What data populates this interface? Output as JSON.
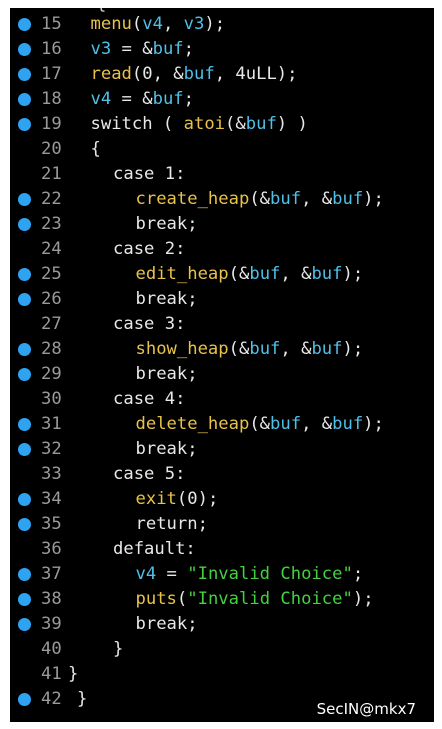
{
  "code_lines": [
    {
      "num": "15",
      "bp": true,
      "indent": 2,
      "tokens": [
        [
          "fn",
          "menu"
        ],
        [
          "p",
          "("
        ],
        [
          "var",
          "v4"
        ],
        [
          "p",
          ", "
        ],
        [
          "var",
          "v3"
        ],
        [
          "p",
          ");"
        ]
      ]
    },
    {
      "num": "16",
      "bp": true,
      "indent": 2,
      "tokens": [
        [
          "var",
          "v3"
        ],
        [
          "p",
          " = &"
        ],
        [
          "var",
          "buf"
        ],
        [
          "p",
          ";"
        ]
      ]
    },
    {
      "num": "17",
      "bp": true,
      "indent": 2,
      "tokens": [
        [
          "fn",
          "read"
        ],
        [
          "p",
          "(0, &"
        ],
        [
          "var",
          "buf"
        ],
        [
          "p",
          ", 4uLL);"
        ]
      ]
    },
    {
      "num": "18",
      "bp": true,
      "indent": 2,
      "tokens": [
        [
          "var",
          "v4"
        ],
        [
          "p",
          " = &"
        ],
        [
          "var",
          "buf"
        ],
        [
          "p",
          ";"
        ]
      ]
    },
    {
      "num": "19",
      "bp": true,
      "indent": 2,
      "tokens": [
        [
          "p",
          "switch ( "
        ],
        [
          "fn",
          "atoi"
        ],
        [
          "p",
          "(&"
        ],
        [
          "var",
          "buf"
        ],
        [
          "p",
          ") )"
        ]
      ]
    },
    {
      "num": "20",
      "bp": false,
      "indent": 2,
      "tokens": [
        [
          "p",
          "{"
        ]
      ]
    },
    {
      "num": "21",
      "bp": false,
      "indent": 3,
      "tokens": [
        [
          "p",
          "case 1:"
        ]
      ]
    },
    {
      "num": "22",
      "bp": true,
      "indent": 4,
      "tokens": [
        [
          "fn",
          "create_heap"
        ],
        [
          "p",
          "(&"
        ],
        [
          "var",
          "buf"
        ],
        [
          "p",
          ", &"
        ],
        [
          "var",
          "buf"
        ],
        [
          "p",
          ");"
        ]
      ]
    },
    {
      "num": "23",
      "bp": true,
      "indent": 4,
      "tokens": [
        [
          "p",
          "break;"
        ]
      ]
    },
    {
      "num": "24",
      "bp": false,
      "indent": 3,
      "tokens": [
        [
          "p",
          "case 2:"
        ]
      ]
    },
    {
      "num": "25",
      "bp": true,
      "indent": 4,
      "tokens": [
        [
          "fn",
          "edit_heap"
        ],
        [
          "p",
          "(&"
        ],
        [
          "var",
          "buf"
        ],
        [
          "p",
          ", &"
        ],
        [
          "var",
          "buf"
        ],
        [
          "p",
          ");"
        ]
      ]
    },
    {
      "num": "26",
      "bp": true,
      "indent": 4,
      "tokens": [
        [
          "p",
          "break;"
        ]
      ]
    },
    {
      "num": "27",
      "bp": false,
      "indent": 3,
      "tokens": [
        [
          "p",
          "case 3:"
        ]
      ]
    },
    {
      "num": "28",
      "bp": true,
      "indent": 4,
      "tokens": [
        [
          "fn",
          "show_heap"
        ],
        [
          "p",
          "(&"
        ],
        [
          "var",
          "buf"
        ],
        [
          "p",
          ", &"
        ],
        [
          "var",
          "buf"
        ],
        [
          "p",
          ");"
        ]
      ]
    },
    {
      "num": "29",
      "bp": true,
      "indent": 4,
      "tokens": [
        [
          "p",
          "break;"
        ]
      ]
    },
    {
      "num": "30",
      "bp": false,
      "indent": 3,
      "tokens": [
        [
          "p",
          "case 4:"
        ]
      ]
    },
    {
      "num": "31",
      "bp": true,
      "indent": 4,
      "tokens": [
        [
          "fn",
          "delete_heap"
        ],
        [
          "p",
          "(&"
        ],
        [
          "var",
          "buf"
        ],
        [
          "p",
          ", &"
        ],
        [
          "var",
          "buf"
        ],
        [
          "p",
          ");"
        ]
      ]
    },
    {
      "num": "32",
      "bp": true,
      "indent": 4,
      "tokens": [
        [
          "p",
          "break;"
        ]
      ]
    },
    {
      "num": "33",
      "bp": false,
      "indent": 3,
      "tokens": [
        [
          "p",
          "case 5:"
        ]
      ]
    },
    {
      "num": "34",
      "bp": true,
      "indent": 4,
      "tokens": [
        [
          "fn",
          "exit"
        ],
        [
          "p",
          "(0);"
        ]
      ]
    },
    {
      "num": "35",
      "bp": true,
      "indent": 4,
      "tokens": [
        [
          "p",
          "return;"
        ]
      ]
    },
    {
      "num": "36",
      "bp": false,
      "indent": 3,
      "tokens": [
        [
          "p",
          "default:"
        ]
      ]
    },
    {
      "num": "37",
      "bp": true,
      "indent": 4,
      "tokens": [
        [
          "var",
          "v4"
        ],
        [
          "p",
          " = "
        ],
        [
          "str",
          "\"Invalid Choice\""
        ],
        [
          "p",
          ";"
        ]
      ]
    },
    {
      "num": "38",
      "bp": true,
      "indent": 4,
      "tokens": [
        [
          "fn",
          "puts"
        ],
        [
          "p",
          "("
        ],
        [
          "str",
          "\"Invalid Choice\""
        ],
        [
          "p",
          ");"
        ]
      ]
    },
    {
      "num": "39",
      "bp": true,
      "indent": 4,
      "tokens": [
        [
          "p",
          "break;"
        ]
      ]
    },
    {
      "num": "40",
      "bp": false,
      "indent": 3,
      "tokens": [
        [
          "p",
          "}"
        ]
      ]
    },
    {
      "num": "41",
      "bp": false,
      "indent": 1,
      "tokens": [
        [
          "p",
          "}"
        ]
      ]
    },
    {
      "num": "42",
      "bp": true,
      "indent": 0,
      "tokens": [
        [
          "p",
          "}"
        ]
      ]
    }
  ],
  "top_fragment": "{",
  "watermark": "SecIN@mkx7",
  "colors": {
    "background": "#000000",
    "plain": "#e8e8e8",
    "function": "#e8c24a",
    "variable": "#4fc0e8",
    "string": "#44d040",
    "line_number": "#9a9a9a",
    "breakpoint": "#2ea3f2"
  }
}
